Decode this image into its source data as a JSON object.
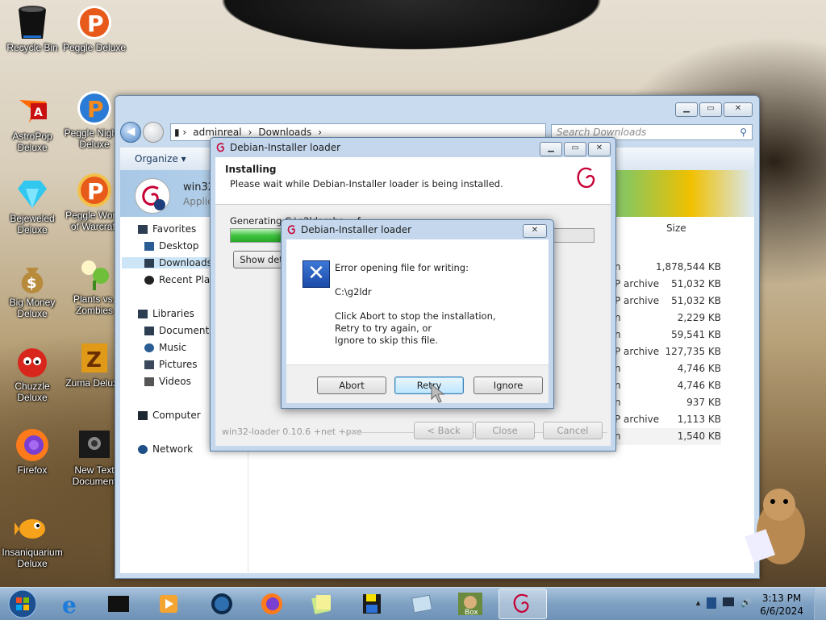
{
  "desktop": {
    "icons": [
      {
        "label": "Recycle Bin",
        "icon": "recycle-bin-icon"
      },
      {
        "label": "Peggle Deluxe",
        "icon": "peggle-icon"
      },
      {
        "label": "AstroPop Deluxe",
        "icon": "astropop-icon"
      },
      {
        "label": "Peggle Nights Deluxe",
        "icon": "peggle-nights-icon"
      },
      {
        "label": "Bejeweled Deluxe",
        "icon": "bejeweled-icon"
      },
      {
        "label": "Peggle World of Warcraft",
        "icon": "peggle-wow-icon"
      },
      {
        "label": "Big Money Deluxe",
        "icon": "money-bag-icon"
      },
      {
        "label": "Plants vs. Zombies",
        "icon": "plants-vs-zombies-icon"
      },
      {
        "label": "Chuzzle Deluxe",
        "icon": "chuzzle-icon"
      },
      {
        "label": "Zuma Deluxe",
        "icon": "zuma-icon"
      },
      {
        "label": "Firefox",
        "icon": "firefox-icon"
      },
      {
        "label": "New Text Document",
        "icon": "text-document-icon"
      },
      {
        "label": "Insaniquarium Deluxe",
        "icon": "insaniquarium-icon"
      }
    ]
  },
  "explorer": {
    "breadcrumb": [
      "adminreal",
      "Downloads"
    ],
    "search_placeholder": "Search Downloads",
    "toolbar": {
      "organize": "Organize"
    },
    "selected_file": {
      "name": "win32",
      "type": "Applic"
    },
    "nav": {
      "favorites": "Favorites",
      "desktop": "Desktop",
      "downloads": "Downloads",
      "recent": "Recent Plac",
      "libraries": "Libraries",
      "documents": "Documents",
      "music": "Music",
      "pictures": "Pictures",
      "videos": "Videos",
      "computer": "Computer",
      "network": "Network"
    },
    "columns": {
      "size": "Size"
    },
    "rows": [
      {
        "type": "n",
        "size": "1,878,544 KB"
      },
      {
        "type": "P archive",
        "size": "51,032 KB"
      },
      {
        "type": "P archive",
        "size": "51,032 KB"
      },
      {
        "type": "n",
        "size": "2,229 KB"
      },
      {
        "type": "n",
        "size": "59,541 KB"
      },
      {
        "type": "P archive",
        "size": "127,735 KB"
      },
      {
        "type": "n",
        "size": "4,746 KB"
      },
      {
        "type": "n",
        "size": "4,746 KB"
      },
      {
        "type": "n",
        "size": "937 KB"
      },
      {
        "type": "P archive",
        "size": "1,113 KB"
      },
      {
        "type": "n",
        "size": "1,540 KB"
      }
    ]
  },
  "installer": {
    "title": "Debian-Installer loader",
    "heading": "Installing",
    "subheading": "Please wait while Debian-Installer loader is being installed.",
    "status": "Generating C:\\g2ldr.mbr ... f",
    "progress": 0.85,
    "show_details": "Show det",
    "brand": "win32-loader 0.10.6 +net +pxe",
    "back": "< Back",
    "close": "Close",
    "cancel": "Cancel"
  },
  "error_dialog": {
    "title": "Debian-Installer loader",
    "line1": "Error opening file for writing:",
    "path": "C:\\g2ldr",
    "line3": "Click Abort to stop the installation,",
    "line4": "Retry to try again, or",
    "line5": "Ignore to skip this file.",
    "abort": "Abort",
    "retry": "Retry",
    "ignore": "Ignore"
  },
  "taskbar": {
    "time": "3:13 PM",
    "date": "6/6/2024"
  },
  "colors": {
    "accent": "#3c7fb1",
    "progress": "#3fc43f"
  }
}
